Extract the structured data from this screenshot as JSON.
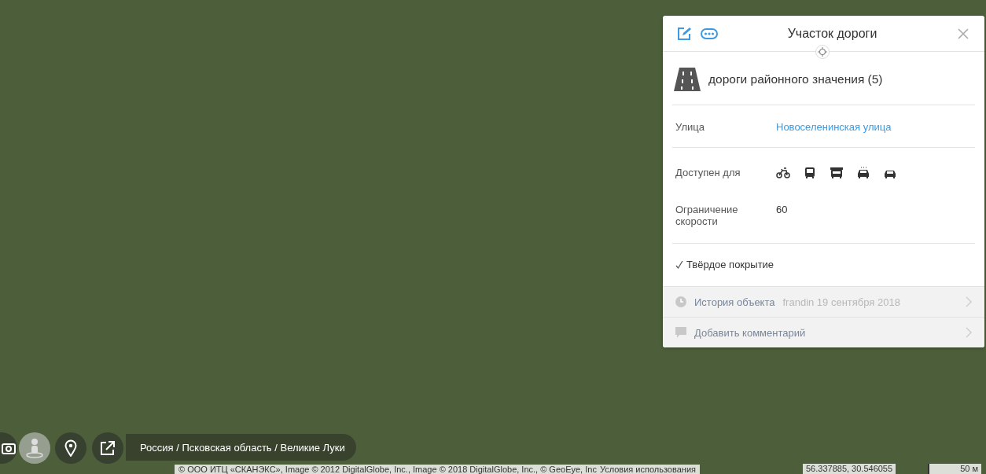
{
  "map": {
    "breadcrumb": "Россия / Псковская область / Великие Луки",
    "attribution": "© ООО ИТЦ «СКАНЭКС», Image © 2012 DigitalGlobe, Inc., Image © 2018 DigitalGlobe, Inc., © GeoEye, Inc",
    "terms_link": "Условия использования",
    "coordinates": "56.337885, 30.546055",
    "scale": "50 м"
  },
  "panel": {
    "title": "Участок дороги",
    "category": "дороги районного значения (5)",
    "fields": [
      {
        "kind": "link",
        "label": "Улица",
        "value": "Новоселенинская улица"
      },
      {
        "kind": "access",
        "label": "Доступен для"
      },
      {
        "kind": "text",
        "label": "Ограничение скорости",
        "value": "60"
      }
    ],
    "paved": {
      "label": "Твёрдое покрытие",
      "checked": true
    },
    "history": {
      "label": "История объекта",
      "meta": "frandin 19 сентября 2018"
    },
    "comment": {
      "label": "Добавить комментарий"
    }
  }
}
